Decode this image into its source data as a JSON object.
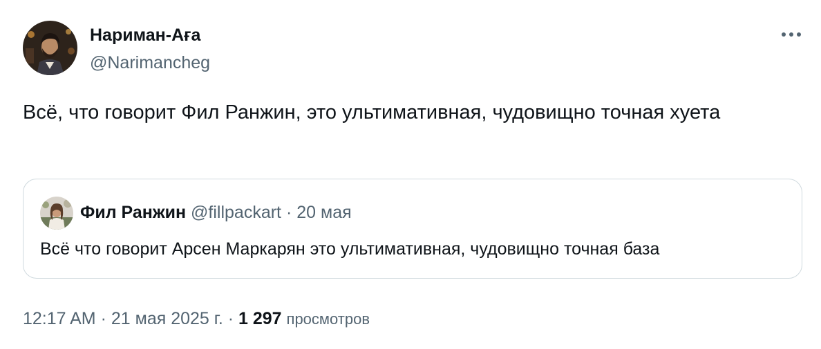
{
  "tweet": {
    "author": {
      "name": "Нариман-Аға",
      "handle": "@Narimancheg"
    },
    "more_icon": "more-horizontal-icon",
    "text": "Всё, что говорит Фил Ранжин, это ультимативная, чудовищно точная хуета",
    "quote": {
      "name": "Фил Ранжин",
      "handle": "@fillpackart",
      "separator": "·",
      "date": "20 мая",
      "text": "Всё что говорит Арсен Маркарян это ультимативная, чудовищно точная база"
    },
    "meta": {
      "time": "12:17 AM",
      "separator": "·",
      "date": "21 мая 2025 г.",
      "views_count": "1 297",
      "views_label": "просмотров"
    }
  },
  "colors": {
    "text_primary": "#0f1419",
    "text_secondary": "#536471",
    "border": "#cfd9de"
  }
}
